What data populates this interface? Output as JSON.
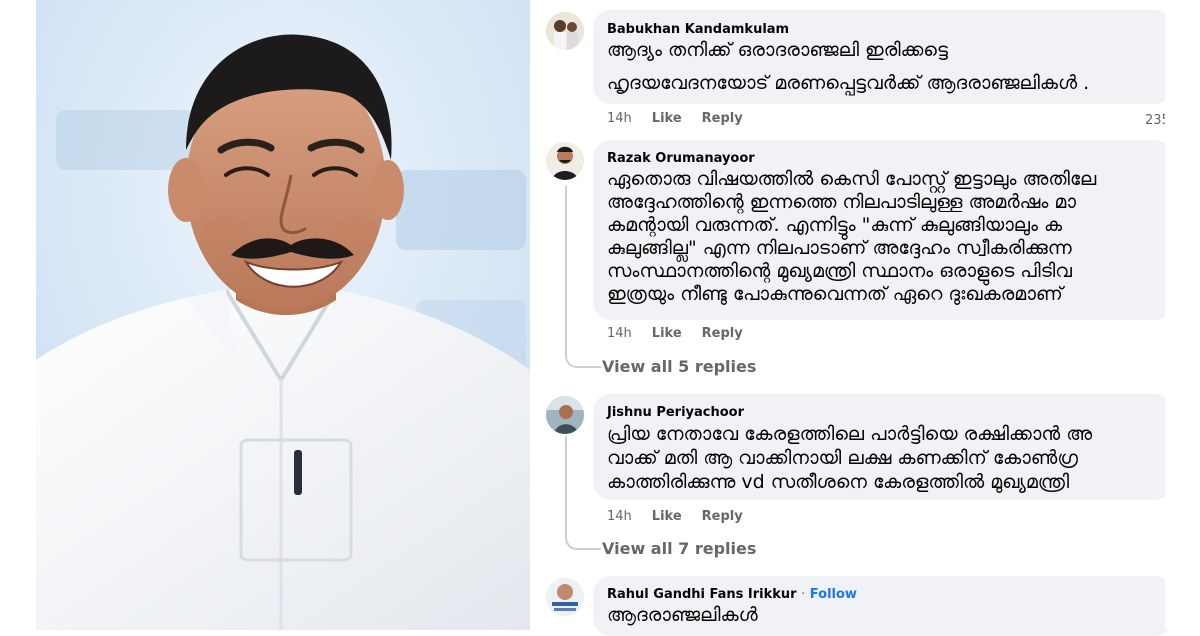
{
  "comments": [
    {
      "author": "Babukhan Kandamkulam",
      "lines": [
        "ആദ്യം തനിക്ക് ഒരാദരാഞ്ജലി ഇരിക്കട്ടെ",
        "ഹൃദയവേദനയോട് മരണപ്പെട്ടവർക്ക് ആദരാഞ്ജലികൾ ."
      ],
      "time": "14h",
      "like": "Like",
      "reply": "Reply",
      "reactions": "235"
    },
    {
      "author": "Razak Orumanayoor",
      "lines": [
        "ഏതൊരു വിഷയത്തിൽ കെസി പോസ്റ്റ് ഇട്ടാലും അതിലേ",
        "അദ്ദേഹത്തിന്റെ ഇന്നത്തെ നിലപാടിലുള്ള അമർഷം മാ",
        "കമന്റായി വരുന്നത്. എന്നിട്ടും \"കുന്ന് കുലുങ്ങിയാലും ക",
        "കുലുങ്ങില്ല\" എന്ന നിലപാടാണ് അദ്ദേഹം സ്വീകരിക്കുന്ന",
        "സംസ്ഥാനത്തിന്റെ മുഖ്യമന്ത്രി സ്ഥാനം ഒരാളുടെ പിടിവ",
        "ഇത്രയും നീണ്ടു പോകുന്നുവെന്നത് ഏറെ ദുഃഖകരമാണ്"
      ],
      "time": "14h",
      "like": "Like",
      "reply": "Reply",
      "view_replies": "View all 5 replies"
    },
    {
      "author": "Jishnu Periyachoor",
      "lines": [
        "പ്രിയ നേതാവേ കേരളത്തിലെ പാർട്ടിയെ രക്ഷിക്കാൻ അ",
        "വാക്ക് മതി ആ വാക്കിനായി ലക്ഷ കണക്കിന് കോൺഗ്ര",
        "കാത്തിരിക്കുന്നു vd സതീശനെ കേരളത്തിൽ മുഖ്യമന്ത്രി"
      ],
      "time": "14h",
      "like": "Like",
      "reply": "Reply",
      "view_replies": "View all 7 replies"
    },
    {
      "author": "Rahul Gandhi Fans Irikkur",
      "follow": "Follow",
      "separator": "·",
      "lines": [
        "ആദരാഞ്ജലികൾ"
      ]
    }
  ],
  "colors": {
    "bubble": "#f0f2f5",
    "meta": "#65676b",
    "link": "#1877f2",
    "photo_bg": "#d6e7f5"
  }
}
